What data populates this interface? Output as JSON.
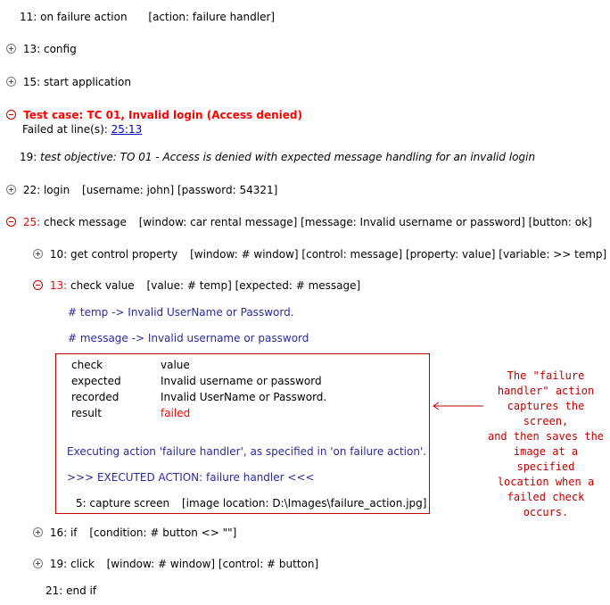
{
  "lines": {
    "on_failure": {
      "num": "11:",
      "cmd": "on failure action",
      "args": "[action: failure handler]"
    },
    "config": {
      "num": "13:",
      "cmd": "config"
    },
    "start_app": {
      "num": "15:",
      "cmd": "start application"
    },
    "test_case": {
      "title": "Test case: TC 01, Invalid login (Access denied)",
      "failed_label": "Failed at line(s):",
      "failed_link": "25:13"
    },
    "objective": {
      "num": "19:",
      "text": "test objective: TO 01 - Access is denied with expected message handling for an invalid login"
    },
    "login": {
      "num": "22:",
      "cmd": "login",
      "args": "[username: john] [password: 54321]"
    },
    "check_message": {
      "num": "25:",
      "cmd": "check message",
      "args": "[window: car rental message] [message: Invalid username or password] [button: ok]"
    },
    "get_control": {
      "num": "10:",
      "cmd": "get control property",
      "args": "[window: # window] [control: message] [property: value] [variable: >> temp]"
    },
    "check_value": {
      "num": "13:",
      "cmd": "check value",
      "args": "[value: # temp] [expected: # message]"
    },
    "temp_eval": "# temp  ->  Invalid UserName or Password.",
    "message_eval": "# message  ->  Invalid username or password",
    "if_line": {
      "num": "16:",
      "cmd": "if",
      "args": "[condition: # button <> \"\"]"
    },
    "click_line": {
      "num": "19:",
      "cmd": "click",
      "args": "[window: # window] [control: # button]"
    },
    "end_if": {
      "num": "21:",
      "cmd": "end if"
    }
  },
  "result_table": {
    "rows": [
      {
        "label": "check",
        "value": "value"
      },
      {
        "label": "expected",
        "value": "Invalid username or password"
      },
      {
        "label": "recorded",
        "value": "Invalid UserName or Password."
      },
      {
        "label": "result",
        "value": "failed"
      }
    ],
    "executing": "Executing action 'failure handler', as specified in 'on failure action'.",
    "executed": ">>> EXECUTED ACTION: failure handler <<<",
    "capture": {
      "num": "5:",
      "cmd": "capture screen",
      "args": "[image location: D:\\Images\\failure_action.jpg]"
    }
  },
  "callout": {
    "lines": [
      "The \"failure",
      "handler\" action",
      "captures the screen,",
      "and then saves the",
      "image at a specified",
      "location when a",
      "failed check occurs."
    ]
  },
  "colors": {
    "error": "#ff0000",
    "blue_text": "#2b2b9c",
    "box_border": "#c00000"
  }
}
